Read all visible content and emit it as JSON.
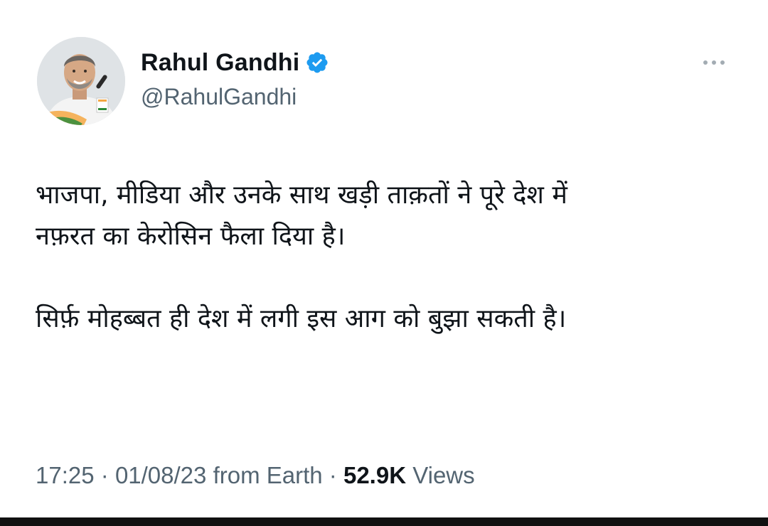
{
  "tweet": {
    "author": {
      "display_name": "Rahul Gandhi",
      "handle": "@RahulGandhi",
      "verified": true,
      "verified_color": "#1d9bf0"
    },
    "text": {
      "paragraph_1_line_1": "भाजपा, मीडिया और उनके साथ खड़ी ताक़तों ने पूरे देश में",
      "paragraph_1_line_2": "नफ़रत का केरोसिन फैला दिया है।",
      "paragraph_2": "सिर्फ़ मोहब्बत ही देश में लगी इस आग को बुझा सकती है।"
    },
    "meta": {
      "time": "17:25",
      "separator": "·",
      "date": "01/08/23",
      "source": "from Earth",
      "views_count": "52.9K",
      "views_label": "Views"
    }
  },
  "icons": {
    "avatar": "avatar-photo",
    "verified": "verified-badge-icon",
    "more": "more-options-icon"
  }
}
